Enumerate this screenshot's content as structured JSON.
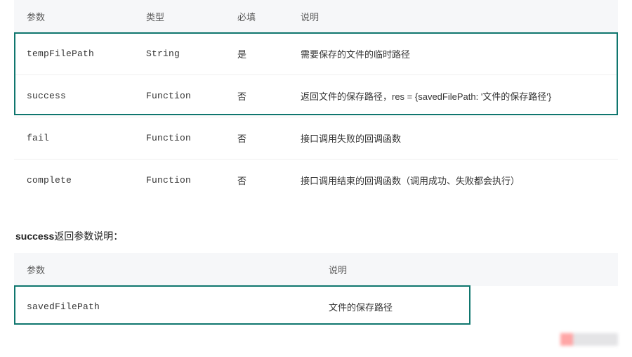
{
  "table1": {
    "headers": {
      "param": "参数",
      "type": "类型",
      "required": "必填",
      "desc": "说明"
    },
    "rows": [
      {
        "param": "tempFilePath",
        "type": "String",
        "required": "是",
        "desc": "需要保存的文件的临时路径"
      },
      {
        "param": "success",
        "type": "Function",
        "required": "否",
        "desc": "返回文件的保存路径，res = {savedFilePath: '文件的保存路径'}"
      },
      {
        "param": "fail",
        "type": "Function",
        "required": "否",
        "desc": "接口调用失败的回调函数"
      },
      {
        "param": "complete",
        "type": "Function",
        "required": "否",
        "desc": "接口调用结束的回调函数（调用成功、失败都会执行）"
      }
    ]
  },
  "section2_title_bold": "success",
  "section2_title_rest": "返回参数说明：",
  "table2": {
    "headers": {
      "param": "参数",
      "desc": "说明"
    },
    "rows": [
      {
        "param": "savedFilePath",
        "desc": "文件的保存路径"
      }
    ]
  }
}
